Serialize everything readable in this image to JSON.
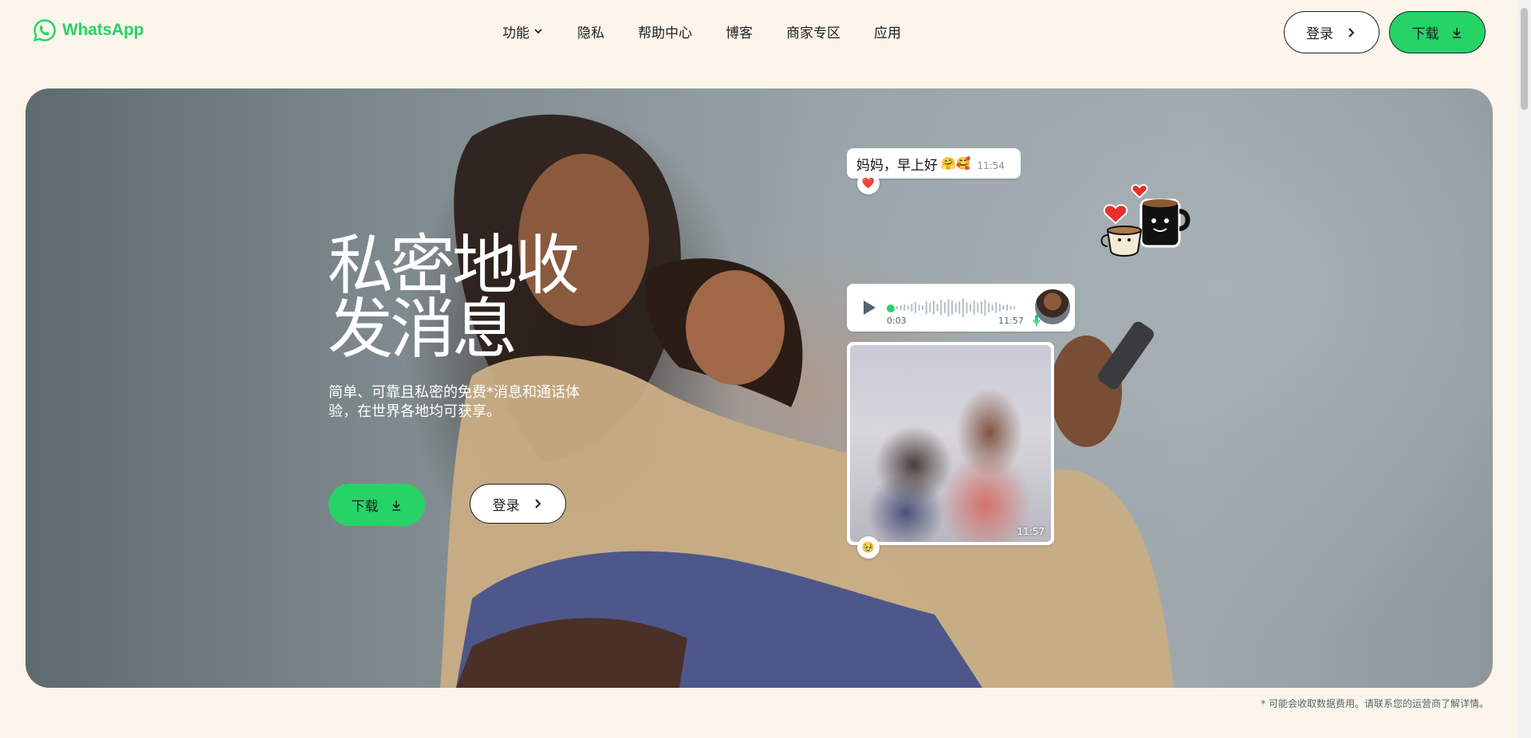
{
  "brand": {
    "name": "WhatsApp",
    "color": "#25d366"
  },
  "nav": {
    "items": [
      {
        "label": "功能",
        "has_dropdown": true
      },
      {
        "label": "隐私"
      },
      {
        "label": "帮助中心"
      },
      {
        "label": "博客"
      },
      {
        "label": "商家专区"
      },
      {
        "label": "应用"
      }
    ]
  },
  "header": {
    "login_label": "登录",
    "download_label": "下载"
  },
  "hero": {
    "title": "私密地收发消息",
    "subtitle": "简单、可靠且私密的免费*消息和通话体验，在世界各地均可获享。",
    "download_label": "下载",
    "login_label": "登录",
    "chat": {
      "text_message": "妈妈，早上好",
      "text_emoji": "🤗🥰",
      "text_time": "11:54",
      "text_reaction": "❤️",
      "voice_elapsed": "0:03",
      "voice_time": "11:57",
      "photo_time": "11:57",
      "photo_reaction": "🥹"
    }
  },
  "footnote": "* 可能会收取数据费用。请联系您的运营商了解详情。",
  "icons": [
    "whatsapp-logo-icon",
    "chevron-down-icon",
    "chevron-right-icon",
    "download-icon",
    "play-icon",
    "mic-icon",
    "coffee-sticker-icon"
  ]
}
